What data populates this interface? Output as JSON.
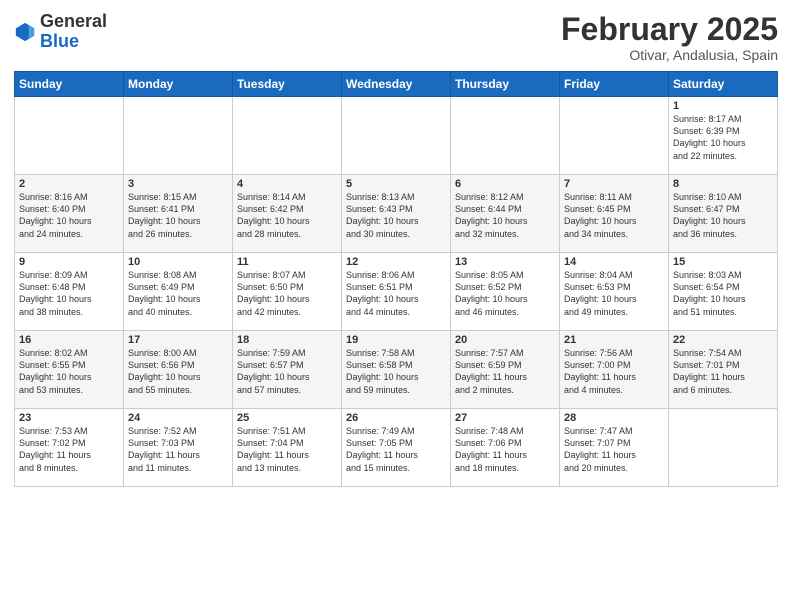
{
  "header": {
    "logo_general": "General",
    "logo_blue": "Blue",
    "month_title": "February 2025",
    "location": "Otivar, Andalusia, Spain"
  },
  "days_of_week": [
    "Sunday",
    "Monday",
    "Tuesday",
    "Wednesday",
    "Thursday",
    "Friday",
    "Saturday"
  ],
  "weeks": [
    [
      {
        "day": "",
        "info": ""
      },
      {
        "day": "",
        "info": ""
      },
      {
        "day": "",
        "info": ""
      },
      {
        "day": "",
        "info": ""
      },
      {
        "day": "",
        "info": ""
      },
      {
        "day": "",
        "info": ""
      },
      {
        "day": "1",
        "info": "Sunrise: 8:17 AM\nSunset: 6:39 PM\nDaylight: 10 hours\nand 22 minutes."
      }
    ],
    [
      {
        "day": "2",
        "info": "Sunrise: 8:16 AM\nSunset: 6:40 PM\nDaylight: 10 hours\nand 24 minutes."
      },
      {
        "day": "3",
        "info": "Sunrise: 8:15 AM\nSunset: 6:41 PM\nDaylight: 10 hours\nand 26 minutes."
      },
      {
        "day": "4",
        "info": "Sunrise: 8:14 AM\nSunset: 6:42 PM\nDaylight: 10 hours\nand 28 minutes."
      },
      {
        "day": "5",
        "info": "Sunrise: 8:13 AM\nSunset: 6:43 PM\nDaylight: 10 hours\nand 30 minutes."
      },
      {
        "day": "6",
        "info": "Sunrise: 8:12 AM\nSunset: 6:44 PM\nDaylight: 10 hours\nand 32 minutes."
      },
      {
        "day": "7",
        "info": "Sunrise: 8:11 AM\nSunset: 6:45 PM\nDaylight: 10 hours\nand 34 minutes."
      },
      {
        "day": "8",
        "info": "Sunrise: 8:10 AM\nSunset: 6:47 PM\nDaylight: 10 hours\nand 36 minutes."
      }
    ],
    [
      {
        "day": "9",
        "info": "Sunrise: 8:09 AM\nSunset: 6:48 PM\nDaylight: 10 hours\nand 38 minutes."
      },
      {
        "day": "10",
        "info": "Sunrise: 8:08 AM\nSunset: 6:49 PM\nDaylight: 10 hours\nand 40 minutes."
      },
      {
        "day": "11",
        "info": "Sunrise: 8:07 AM\nSunset: 6:50 PM\nDaylight: 10 hours\nand 42 minutes."
      },
      {
        "day": "12",
        "info": "Sunrise: 8:06 AM\nSunset: 6:51 PM\nDaylight: 10 hours\nand 44 minutes."
      },
      {
        "day": "13",
        "info": "Sunrise: 8:05 AM\nSunset: 6:52 PM\nDaylight: 10 hours\nand 46 minutes."
      },
      {
        "day": "14",
        "info": "Sunrise: 8:04 AM\nSunset: 6:53 PM\nDaylight: 10 hours\nand 49 minutes."
      },
      {
        "day": "15",
        "info": "Sunrise: 8:03 AM\nSunset: 6:54 PM\nDaylight: 10 hours\nand 51 minutes."
      }
    ],
    [
      {
        "day": "16",
        "info": "Sunrise: 8:02 AM\nSunset: 6:55 PM\nDaylight: 10 hours\nand 53 minutes."
      },
      {
        "day": "17",
        "info": "Sunrise: 8:00 AM\nSunset: 6:56 PM\nDaylight: 10 hours\nand 55 minutes."
      },
      {
        "day": "18",
        "info": "Sunrise: 7:59 AM\nSunset: 6:57 PM\nDaylight: 10 hours\nand 57 minutes."
      },
      {
        "day": "19",
        "info": "Sunrise: 7:58 AM\nSunset: 6:58 PM\nDaylight: 10 hours\nand 59 minutes."
      },
      {
        "day": "20",
        "info": "Sunrise: 7:57 AM\nSunset: 6:59 PM\nDaylight: 11 hours\nand 2 minutes."
      },
      {
        "day": "21",
        "info": "Sunrise: 7:56 AM\nSunset: 7:00 PM\nDaylight: 11 hours\nand 4 minutes."
      },
      {
        "day": "22",
        "info": "Sunrise: 7:54 AM\nSunset: 7:01 PM\nDaylight: 11 hours\nand 6 minutes."
      }
    ],
    [
      {
        "day": "23",
        "info": "Sunrise: 7:53 AM\nSunset: 7:02 PM\nDaylight: 11 hours\nand 8 minutes."
      },
      {
        "day": "24",
        "info": "Sunrise: 7:52 AM\nSunset: 7:03 PM\nDaylight: 11 hours\nand 11 minutes."
      },
      {
        "day": "25",
        "info": "Sunrise: 7:51 AM\nSunset: 7:04 PM\nDaylight: 11 hours\nand 13 minutes."
      },
      {
        "day": "26",
        "info": "Sunrise: 7:49 AM\nSunset: 7:05 PM\nDaylight: 11 hours\nand 15 minutes."
      },
      {
        "day": "27",
        "info": "Sunrise: 7:48 AM\nSunset: 7:06 PM\nDaylight: 11 hours\nand 18 minutes."
      },
      {
        "day": "28",
        "info": "Sunrise: 7:47 AM\nSunset: 7:07 PM\nDaylight: 11 hours\nand 20 minutes."
      },
      {
        "day": "",
        "info": ""
      }
    ]
  ]
}
